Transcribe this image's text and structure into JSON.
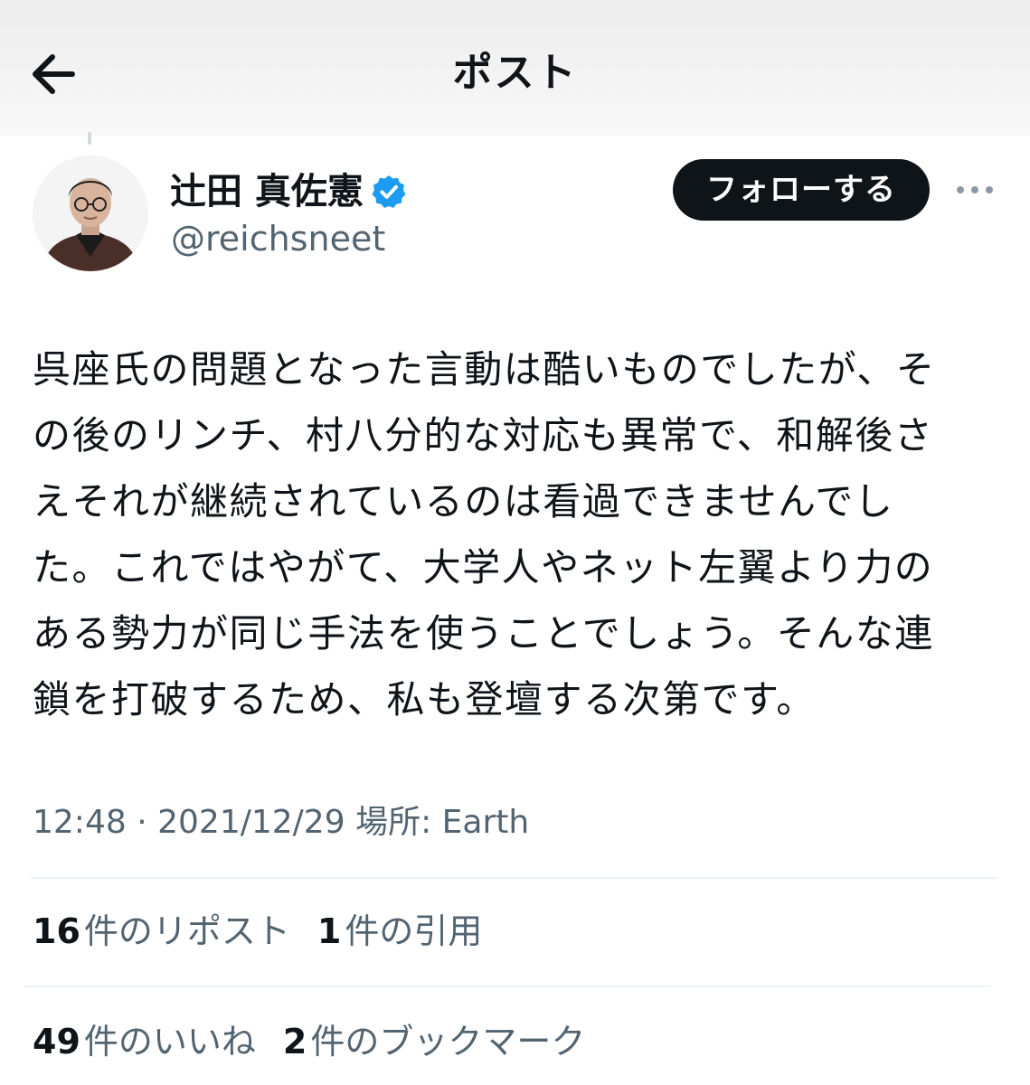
{
  "header": {
    "title": "ポスト",
    "back_icon": "arrow-left-icon"
  },
  "author": {
    "display_name": "辻田 真佐憲",
    "username": "@reichsneet",
    "verified_icon": "verified-badge-icon",
    "avatar_icon": "avatar-photo"
  },
  "follow_button": {
    "label": "フォローする"
  },
  "more_icon": "more-horizontal-icon",
  "post": {
    "lines": [
      "呉座氏の問題となった言動は酷いものでしたが、そ",
      "の後のリンチ、村八分的な対応も異常で、和解後さ",
      "えそれが継続されているのは看過できませんでし",
      "た。これではやがて、大学人やネット左翼より力の",
      "ある勢力が同じ手法を使うことでしょう。そんな連",
      "鎖を打破するため、私も登壇する次第です。"
    ]
  },
  "meta": {
    "time": "12:48",
    "separator": "·",
    "date": "2021/12/29",
    "location_label": "場所:",
    "location": "Earth"
  },
  "stats": {
    "reposts": {
      "count": "16",
      "label": "件のリポスト"
    },
    "quotes": {
      "count": "1",
      "label": "件の引用"
    },
    "likes": {
      "count": "49",
      "label": "件のいいね"
    },
    "bookmarks": {
      "count": "2",
      "label": "件のブックマーク"
    }
  },
  "colors": {
    "text_primary": "#0f1419",
    "text_secondary": "#536471",
    "verified_blue": "#1d9bf0",
    "follow_button_bg": "#0f1419",
    "divider": "#eff3f4"
  }
}
